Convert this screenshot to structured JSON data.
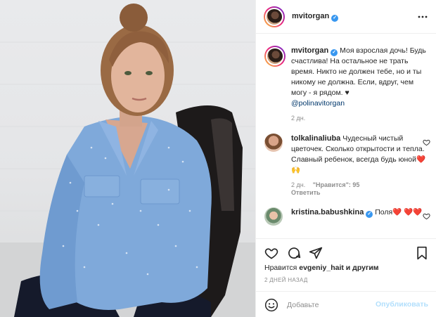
{
  "post": {
    "author": "mvitorgan",
    "caption": "Моя взрослая дочь! Будь счастлива! На остальное не трать время. Никто не должен тебе, но и ты никому не должна. Если, вдруг, чем могу - я рядом. ♥",
    "mention": "@polinavitorgan",
    "time": "2 дн."
  },
  "comments": [
    {
      "user": "tolkalinaliuba",
      "text": "Чудесный чистый цветочек. Сколько открытости и тепла. Славный ребенок, всегда будь юной❤️🙌",
      "time": "2 дн.",
      "likes": "\"Нравится\": 95",
      "reply": "Ответить"
    },
    {
      "user": "kristina.babushkina",
      "text": "Поля❤️ ❤️❤️"
    }
  ],
  "likes": {
    "prefix": "Нравится ",
    "user": "evgeniy_hait",
    "suffix": " и другим"
  },
  "date_label": "2 ДНЕЙ НАЗАД",
  "add_comment": {
    "placeholder": "Добавьте",
    "post_label": "Опубликовать"
  },
  "icons": {
    "like": "heart-icon",
    "comment": "comment-icon",
    "share": "share-icon",
    "save": "bookmark-icon",
    "more": "more-icon",
    "emoji": "emoji-icon",
    "verified": "verified-badge"
  },
  "colors": {
    "verified": "#3897f0",
    "post_disabled": "#b2dffc",
    "heart": "#ed4956"
  }
}
